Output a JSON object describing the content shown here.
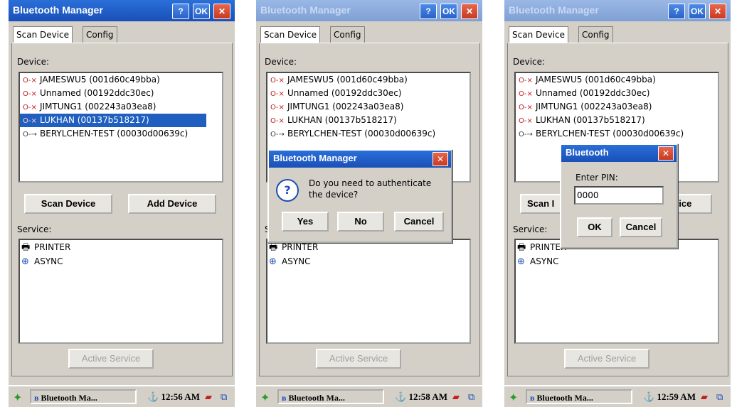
{
  "window": {
    "title": "Bluetooth Manager",
    "help_label": "?",
    "ok_label": "OK",
    "close_label": "✕"
  },
  "tabs": [
    "Scan Device",
    "Config"
  ],
  "device_label": "Device:",
  "devices": [
    {
      "name": "JAMESWU5 (001d60c49bba)",
      "icon": "bt-unpaired-icon"
    },
    {
      "name": "Unnamed (00192ddc30ec)",
      "icon": "bt-unpaired-icon"
    },
    {
      "name": "JIMTUNG1 (002243a03ea8)",
      "icon": "bt-unpaired-icon"
    },
    {
      "name": "LUKHAN (00137b518217)",
      "icon": "bt-unpaired-icon"
    },
    {
      "name": "BERYLCHEN-TEST (00030d00639c)",
      "icon": "bt-paired-icon"
    }
  ],
  "buttons": {
    "scan": "Scan Device",
    "add": "Add Device",
    "active_service": "Active Service"
  },
  "service_label": "Service:",
  "services": [
    {
      "name": "PRINTER",
      "icon": "printer-icon"
    },
    {
      "name": "ASYNC",
      "icon": "async-icon"
    }
  ],
  "screens": [
    {
      "clock": "12:56 AM",
      "task": "Bluetooth Ma...",
      "selected_device_index": 3
    },
    {
      "clock": "12:58 AM",
      "task": "Bluetooth Ma...",
      "selected_device_index": null
    },
    {
      "clock": "12:59 AM",
      "task": "Bluetooth Ma...",
      "selected_device_index": null
    }
  ],
  "auth_dialog": {
    "title": "Bluetooth Manager",
    "message_line1": "Do you need to authenticate",
    "message_line2": "the device?",
    "yes": "Yes",
    "no": "No",
    "cancel": "Cancel",
    "close_label": "✕",
    "icon": "question-icon"
  },
  "pin_dialog": {
    "title": "Bluetooth",
    "label": "Enter PIN:",
    "value": "0000",
    "ok": "OK",
    "cancel": "Cancel",
    "close_label": "✕"
  },
  "partial_labels": {
    "scan_left": "Scan I",
    "add_right": "vice",
    "service_clipped": "Se",
    "scan_clipped": "S"
  },
  "colors": {
    "titlebar": "#1a4fb8",
    "selection": "#1f5fbf",
    "face": "#d4d0c8"
  }
}
